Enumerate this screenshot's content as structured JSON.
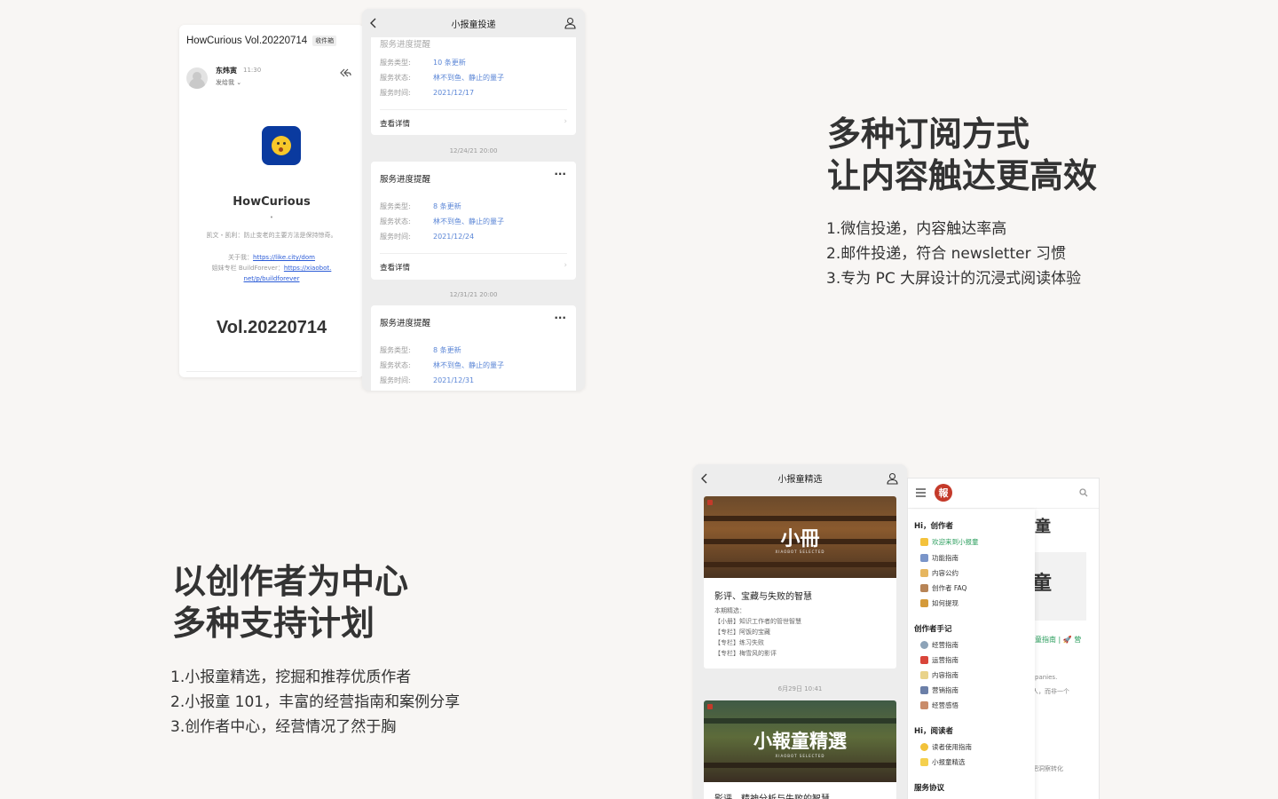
{
  "email": {
    "subject": "HowCurious Vol.20220714",
    "inbox_tag": "收件箱",
    "sender_name": "东炜寅",
    "sender_time": "11:30",
    "sender_to": "发给我 ⌄",
    "brand_name": "HowCurious",
    "brand_dot": "•",
    "brand_desc": "凯文・凯利：防止变老的主要方法是保持惊奇。",
    "about_label": "关于我：",
    "about_link": "https://like.city/dom",
    "column_label": "姐妹专栏 BuildForever：",
    "column_link_1": "https://xiaobot.",
    "column_link_2": "net/p/buildforever",
    "vol": "Vol.20220714"
  },
  "chat": {
    "title": "小报童投递",
    "top_cut_title": "服务进度提醒",
    "label_type": "服务类型:",
    "label_status": "服务状态:",
    "label_time": "服务时间:",
    "detail": "查看详情",
    "more": "···",
    "card_title": "服务进度提醒",
    "cards": [
      {
        "type": "10 条更新",
        "status": "林不到鱼、静止的量子",
        "time": "2021/12/17"
      },
      {
        "type": "8 条更新",
        "status": "林不到鱼、静止的量子",
        "time": "2021/12/24"
      },
      {
        "type": "8 条更新",
        "status": "林不到鱼、静止的量子",
        "time": "2021/12/31"
      }
    ],
    "ts1": "12/24/21 20:00",
    "ts2": "12/31/21 20:00"
  },
  "section1": {
    "heading_1": "多种订阅方式",
    "heading_2": "让内容触达更高效",
    "features": [
      "1.微信投递，内容触达率高",
      "2.邮件投递，符合 newsletter 习惯",
      "3.专为 PC 大屏设计的沉浸式阅读体验"
    ]
  },
  "section2": {
    "heading_1": "以创作者为中心",
    "heading_2": "多种支持计划",
    "features": [
      "1.小报童精选，挖掘和推荐优质作者",
      "2.小报童 101，丰富的经营指南和案例分享",
      "3.创作者中心，经营情况了然于胸"
    ]
  },
  "phone2": {
    "title": "小报童精选",
    "cover1_text": "小冊",
    "cover_sub": "XIAOBOT SELECTED",
    "art1_title": "影评、宝藏与失败的智慧",
    "art1_lines": [
      "本期精选：",
      "【小册】知识工作者的管世智慧",
      "【专栏】阿饭的宝藏",
      "【专栏】练习失败",
      "【专栏】梅雪风的影评"
    ],
    "ts": "6月29日 10:41",
    "cover2_text": "小報童精選",
    "art2_title": "影评、精神分析与失败的智慧"
  },
  "desktop": {
    "logo": "報",
    "section_creator": "Hi，创作者",
    "creator_items": [
      "欢迎来到小报童",
      "功能指南",
      "内容公约",
      "创作者 FAQ",
      "如何提现"
    ],
    "section_notes": "创作者手记",
    "notes_items": [
      "经营指南",
      "运营指南",
      "内容指南",
      "营销指南",
      "经营感悟"
    ],
    "section_reader": "Hi，阅读者",
    "reader_items": [
      "读者使用指南",
      "小报童精选"
    ],
    "section_terms": "服务协议",
    "bg_green": "童指南 | 🚀 营",
    "bg_text_1": "panies.",
    "bg_text_2": "人，而非一个",
    "bg_text_3": "把洞察转化"
  }
}
